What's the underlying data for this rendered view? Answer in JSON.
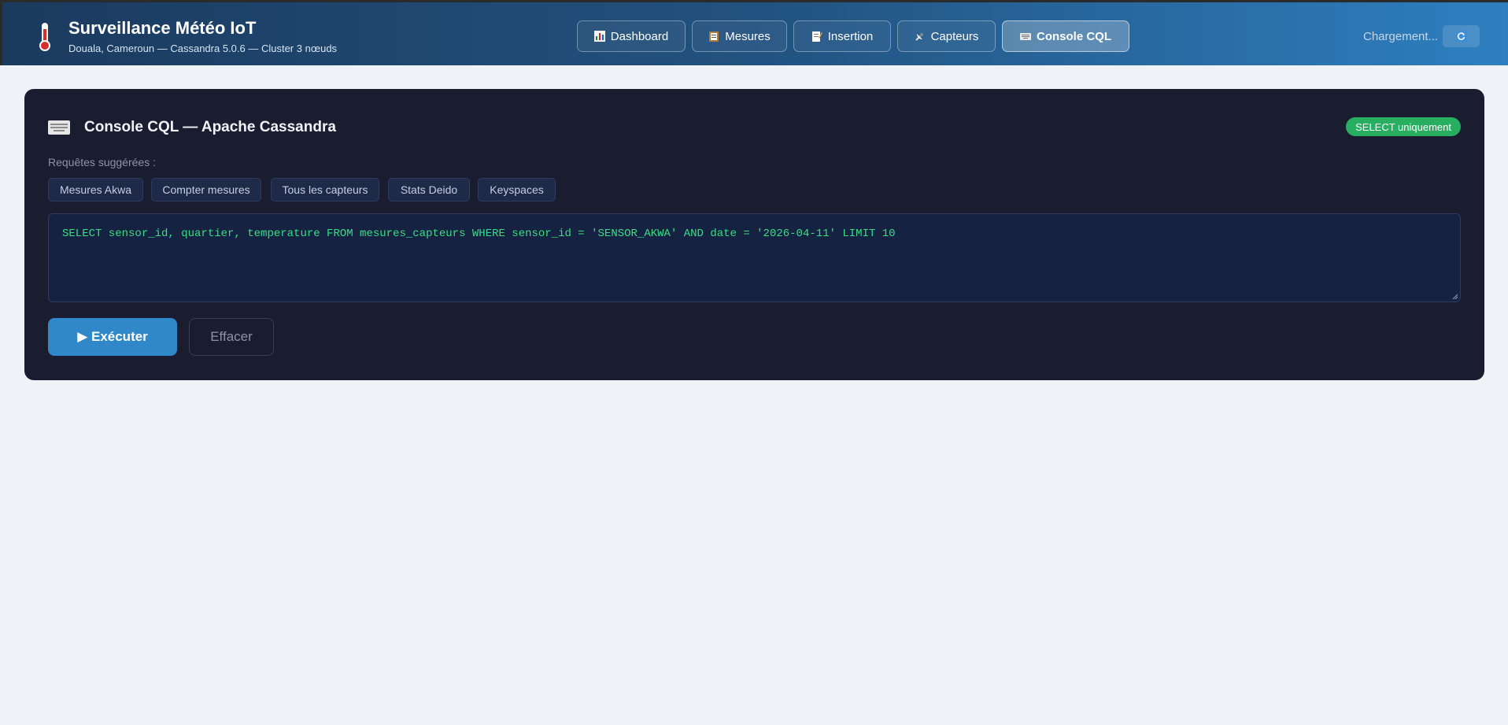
{
  "app": {
    "title": "Surveillance Météo IoT",
    "subtitle": "Douala, Cameroun — Cassandra 5.0.6 — Cluster 3 nœuds",
    "icon": "thermometer-icon"
  },
  "nav": {
    "tabs": [
      {
        "label": "Dashboard",
        "icon": "bar-chart-icon",
        "active": false
      },
      {
        "label": "Mesures",
        "icon": "clipboard-icon",
        "active": false
      },
      {
        "label": "Insertion",
        "icon": "memo-icon",
        "active": false
      },
      {
        "label": "Capteurs",
        "icon": "satellite-icon",
        "active": false
      },
      {
        "label": "Console CQL",
        "icon": "keyboard-icon",
        "active": true
      }
    ]
  },
  "status": {
    "text": "Chargement...",
    "refresh_icon": "refresh-icon"
  },
  "console": {
    "title": "Console CQL — Apache Cassandra",
    "icon": "keyboard-icon",
    "badge": "SELECT uniquement",
    "suggest_label": "Requêtes suggérées :",
    "suggestions": [
      "Mesures Akwa",
      "Compter mesures",
      "Tous les capteurs",
      "Stats Deido",
      "Keyspaces"
    ],
    "query": "SELECT sensor_id, quartier, temperature FROM mesures_capteurs WHERE sensor_id = 'SENSOR_AKWA' AND date = '2026-04-11' LIMIT 10",
    "run_label": "▶ Exécuter",
    "clear_label": "Effacer"
  },
  "colors": {
    "header_start": "#1b3a5e",
    "header_end": "#2e7fc0",
    "card_bg": "#1a1d30",
    "badge_green": "#27ae60",
    "query_text": "#3ddc84",
    "primary_button": "#3188c9"
  }
}
